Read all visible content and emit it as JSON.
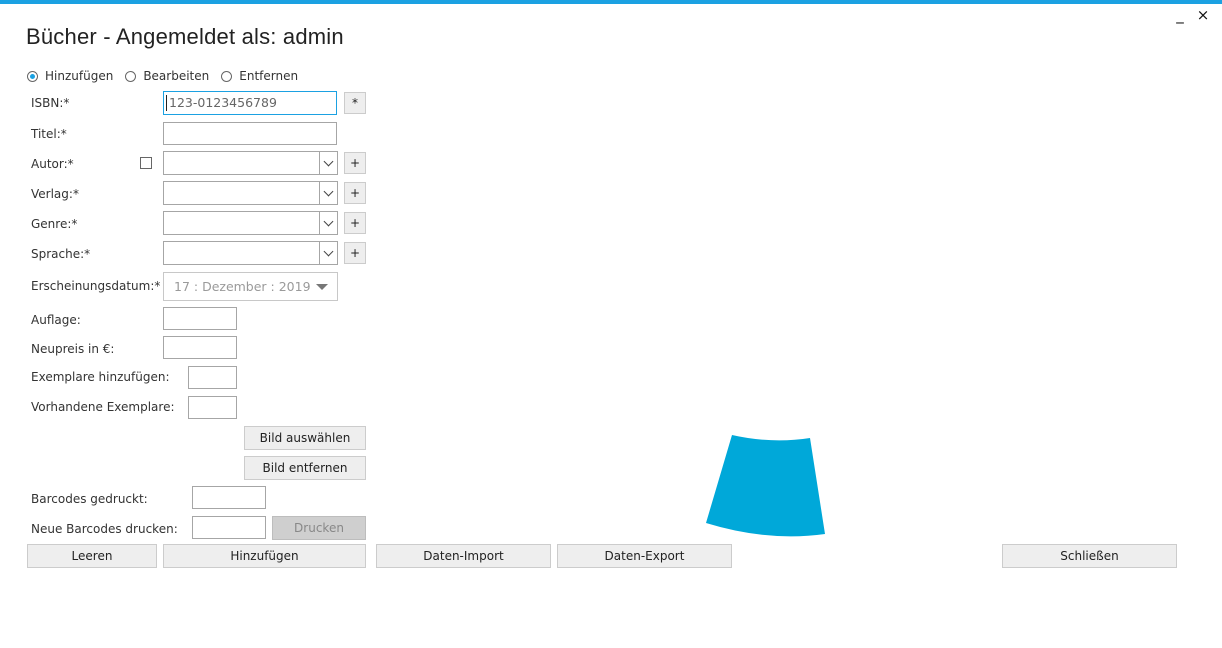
{
  "window": {
    "title": "Bücher - Angemeldet als: admin",
    "minimize_glyph": "_",
    "close_glyph": "×"
  },
  "mode": {
    "options": [
      "Hinzufügen",
      "Bearbeiten",
      "Entfernen"
    ],
    "selected": "Hinzufügen"
  },
  "form": {
    "isbn_label": "ISBN:*",
    "isbn_value": "123-0123456789",
    "isbn_button": "*",
    "titel_label": "Titel:*",
    "titel_value": "",
    "autor_label": "Autor:*",
    "autor_checked": false,
    "verlag_label": "Verlag:*",
    "genre_label": "Genre:*",
    "sprache_label": "Sprache:*",
    "add_button": "+",
    "datum_label": "Erscheinungsdatum:*",
    "datum_value": "17 : Dezember : 2019",
    "auflage_label": "Auflage:",
    "neupreis_label": "Neupreis in €:",
    "exemplare_hinzufuegen_label": "Exemplare hinzufügen:",
    "vorhandene_exemplare_label": "Vorhandene Exemplare:",
    "barcodes_gedruckt_label": "Barcodes gedruckt:",
    "neue_barcodes_label": "Neue Barcodes drucken:"
  },
  "buttons": {
    "bild_auswaehlen": "Bild auswählen",
    "bild_entfernen": "Bild entfernen",
    "drucken": "Drucken",
    "leeren": "Leeren",
    "hinzufuegen": "Hinzufügen",
    "daten_import": "Daten-Import",
    "daten_export": "Daten-Export",
    "schliessen": "Schließen"
  },
  "colors": {
    "accent": "#1ba1e2",
    "spinner": "#00a8d9"
  }
}
